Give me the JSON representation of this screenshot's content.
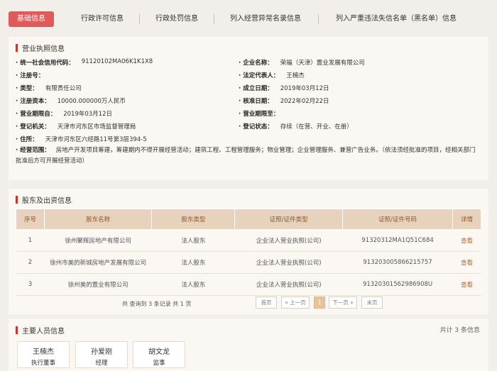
{
  "tabs": [
    {
      "label": "基础信息",
      "active": true
    },
    {
      "label": "行政许可信息"
    },
    {
      "label": "行政处罚信息"
    },
    {
      "label": "列入经营异常名录信息"
    },
    {
      "label": "列入严重违法失信名单（黑名单）信息"
    }
  ],
  "license": {
    "title": "营业执照信息",
    "credit_code_k": "统一社会信用代码：",
    "credit_code_v": "91120102MA06K1K1X8",
    "company_k": "企业名称：",
    "company_v": "荣福（天津）置业发展有限公司",
    "reg_no_k": "注册号：",
    "reg_no_v": "",
    "legal_k": "法定代表人：",
    "legal_v": "王楠杰",
    "type_k": "类型：",
    "type_v": "有限责任公司",
    "est_k": "成立日期：",
    "est_v": "2019年03月12日",
    "capital_k": "注册资本：",
    "capital_v": "10000.000000万人民币",
    "approve_k": "核准日期：",
    "approve_v": "2022年02月22日",
    "term_from_k": "营业期限自：",
    "term_from_v": "2019年03月12日",
    "term_to_k": "营业期限至：",
    "term_to_v": "",
    "authority_k": "登记机关：",
    "authority_v": "天津市河东区市场监督管理局",
    "status_k": "登记状态：",
    "status_v": "存续（在营、开业、在册）",
    "address_k": "住所：",
    "address_v": "天津市河东区六经路11号第3层394-5",
    "scope_k": "经营范围：",
    "scope_v": "房地产开发项目筹建，筹建期内不得开展经营活动；建筑工程、工程管理服务；物业管理；企业管理服务、兼营广告业务。（依法须经批准的项目，经相关部门批准后方可开展经营活动）"
  },
  "shareholders": {
    "title": "股东及出资信息",
    "headers": [
      "序号",
      "股东名称",
      "股东类型",
      "证照/证件类型",
      "证照/证件号码",
      "详情"
    ],
    "rows": [
      [
        "1",
        "徐州聚辉房地产有限公司",
        "法人股东",
        "企业法人营业执照(公司)",
        "91320312MA1Q51C684",
        "查看"
      ],
      [
        "2",
        "徐州市美的新城房地产发展有限公司",
        "法人股东",
        "企业法人营业执照(公司)",
        "913203005866215757",
        "查看"
      ],
      [
        "3",
        "徐州美的置业有限公司",
        "法人股东",
        "企业法人营业执照(公司)",
        "91320301562986908U",
        "查看"
      ]
    ],
    "pager": {
      "summary": "共 查询到 3 条记录 共 1 页",
      "first": "首页",
      "prev": "« 上一页",
      "current": "1",
      "next": "下一页 »",
      "last": "末页"
    }
  },
  "personnel": {
    "title": "主要人员信息",
    "total": "共计 3 条信息",
    "people": [
      {
        "name": "王楠杰",
        "role": "执行董事"
      },
      {
        "name": "孙爱刚",
        "role": "经理"
      },
      {
        "name": "胡文龙",
        "role": "监事"
      }
    ]
  },
  "colors": {
    "accent": "#e05a5a",
    "section_bar": "#c9352e",
    "table_header": "#e6d2bd",
    "link": "#b06a2e"
  }
}
